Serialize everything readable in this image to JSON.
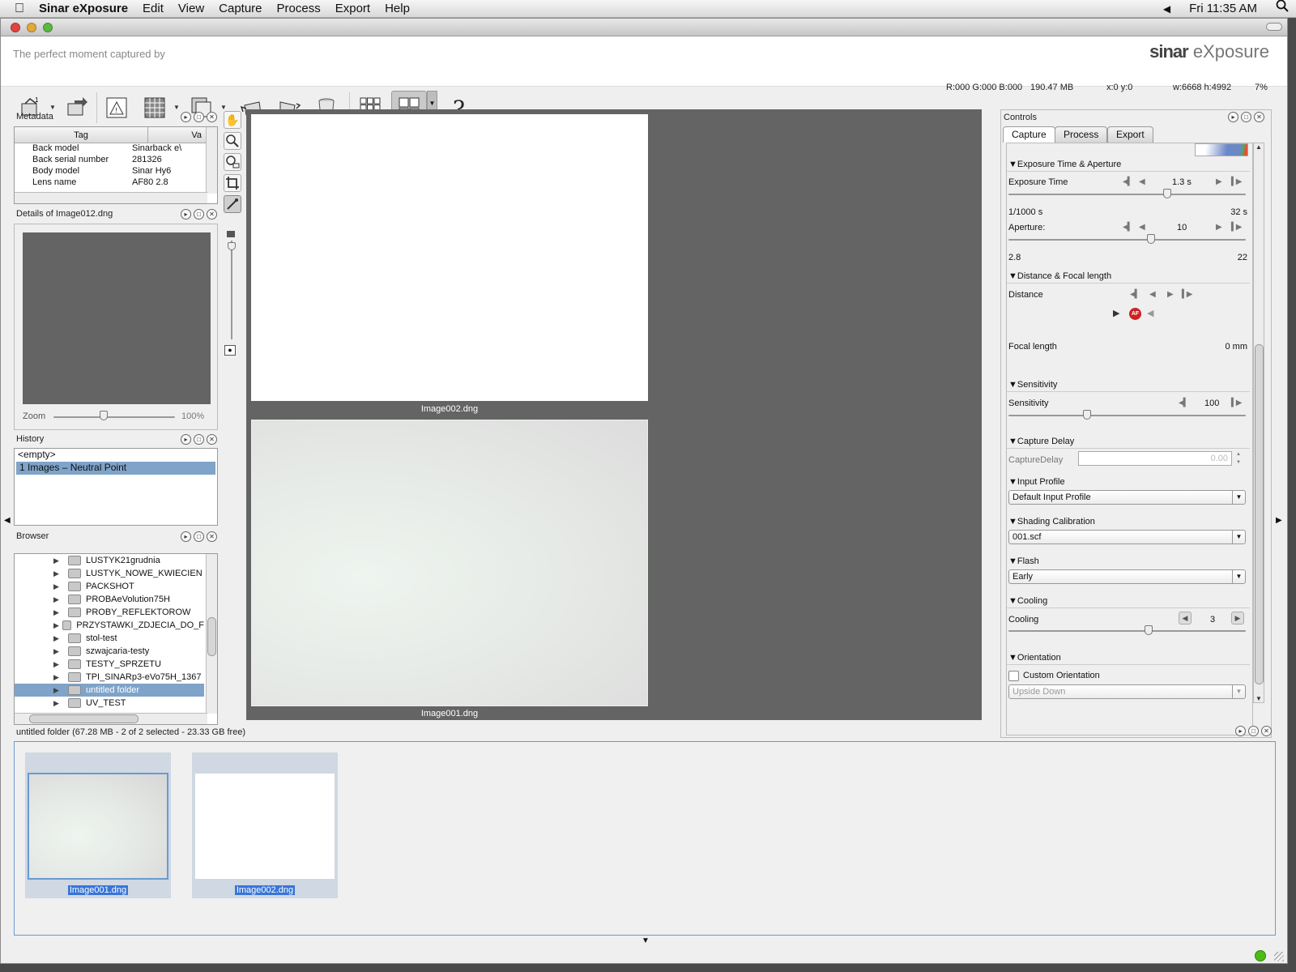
{
  "menubar": {
    "app_name": "Sinar eXposure",
    "items": [
      "Edit",
      "View",
      "Capture",
      "Process",
      "Export",
      "Help"
    ],
    "clock": "Fri 11:35 AM"
  },
  "banner": {
    "tagline": "The perfect moment captured by",
    "brand_bold": "sinar",
    "brand_light": " eXposure"
  },
  "status": {
    "rgb": "R:000 G:000 B:000",
    "size": "190.47 MB",
    "coords": "x:0 y:0",
    "dims": "w:6668 h:4992",
    "zoom": "7%"
  },
  "metadata": {
    "title": "Metadata",
    "col_tag": "Tag",
    "col_value": "Va",
    "rows": [
      {
        "tag": "Back model",
        "value": "Sinarback e\\"
      },
      {
        "tag": "Back serial number",
        "value": "281326"
      },
      {
        "tag": "Body model",
        "value": "Sinar Hy6"
      },
      {
        "tag": "Lens name",
        "value": "AF80 2.8"
      }
    ]
  },
  "details": {
    "title": "Details of Image012.dng",
    "zoom_label": "Zoom",
    "zoom_value": "100%"
  },
  "history": {
    "title": "History",
    "items": [
      "<empty>",
      "1 Images – Neutral Point"
    ]
  },
  "browser": {
    "title": "Browser",
    "folders": [
      "LUSTYK21grudnia",
      "LUSTYK_NOWE_KWIECIEN",
      "PACKSHOT",
      "PROBAeVolution75H",
      "PROBY_REFLEKTOROW",
      "PRZYSTAWKI_ZDJECIA_DO_F",
      "stol-test",
      "szwajcaria-testy",
      "TESTY_SPRZETU",
      "TPI_SINARp3-eVo75H_1367",
      "untitled folder",
      "UV_TEST"
    ],
    "selected_index": 10
  },
  "viewer": {
    "images": [
      "Image002.dng",
      "Image001.dng"
    ]
  },
  "controls": {
    "title": "Controls",
    "tabs": [
      "Capture",
      "Process",
      "Export"
    ],
    "exposure": {
      "section": "▼Exposure Time & Aperture",
      "time_label": "Exposure Time",
      "time_value": "1.3 s",
      "time_min": "1/1000 s",
      "time_max": "32 s",
      "time_pos": 0.67,
      "aperture_label": "Aperture:",
      "aperture_value": "10",
      "aperture_min": "2.8",
      "aperture_max": "22",
      "aperture_pos": 0.6
    },
    "distance": {
      "section": "▼Distance & Focal length",
      "distance_label": "Distance",
      "focal_label": "Focal length",
      "focal_value": "0 mm",
      "af_badge": "AF"
    },
    "sensitivity": {
      "section": "▼Sensitivity",
      "label": "Sensitivity",
      "value": "100",
      "pos": 0.33
    },
    "capture_delay": {
      "section": "▼Capture Delay",
      "label": "CaptureDelay",
      "value": "0.00"
    },
    "input_profile": {
      "section": "▼Input Profile",
      "value": "Default Input Profile"
    },
    "shading": {
      "section": "▼Shading Calibration",
      "value": "001.scf"
    },
    "flash": {
      "section": "▼Flash",
      "value": "Early"
    },
    "cooling": {
      "section": "▼Cooling",
      "label": "Cooling",
      "value": "3",
      "pos": 0.59
    },
    "orientation": {
      "section": "▼Orientation",
      "checkbox_label": "Custom Orientation",
      "value": "Upside Down"
    }
  },
  "filmstrip": {
    "label": "untitled folder (67.28 MB - 2 of 2 selected - 23.33 GB free)",
    "thumbs": [
      "Image001.dng",
      "Image002.dng"
    ]
  },
  "colors": {
    "selection": "#7fa3c9",
    "viewer_bg": "#646464",
    "status_ok": "#4cbb17"
  }
}
